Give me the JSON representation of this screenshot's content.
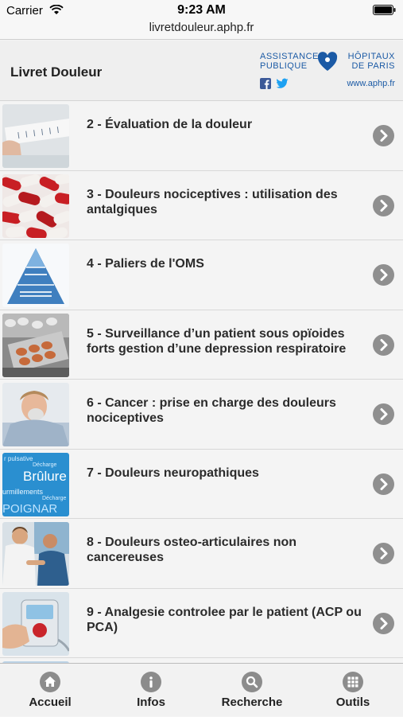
{
  "status": {
    "carrier": "Carrier",
    "time": "9:23 AM"
  },
  "browser": {
    "url": "livretdouleur.aphp.fr"
  },
  "header": {
    "title": "Livret Douleur",
    "logo": {
      "left_line1": "ASSISTANCE",
      "left_line2": "PUBLIQUE",
      "right_line1": "HÔPITAUX",
      "right_line2": "DE PARIS",
      "url": "www.aphp.fr",
      "brand_color": "#1b5aa5"
    }
  },
  "list": {
    "items": [
      {
        "label": "2 - Évaluation de la douleur",
        "thumb": "pain-scale-ruler"
      },
      {
        "label": "3 - Douleurs nociceptives : utilisation des antalgiques",
        "thumb": "capsules"
      },
      {
        "label": "4 - Paliers de l'OMS",
        "thumb": "pyramid"
      },
      {
        "label": "5 - Surveillance d’un patient sous opïoides forts gestion d’une depression respiratoire",
        "thumb": "pills-blister"
      },
      {
        "label": "6 - Cancer : prise en charge des douleurs nociceptives",
        "thumb": "patient-oxygen-mask"
      },
      {
        "label": "7 - Douleurs neuropathiques",
        "thumb": "word-cloud-brulure"
      },
      {
        "label": "8 - Douleurs osteo-articulaires non cancereuses",
        "thumb": "doctor-patient"
      },
      {
        "label": "9 - Analgesie controlee par le patient (ACP ou PCA)",
        "thumb": "pca-pump"
      }
    ],
    "thumb_word_cloud": {
      "line1": "r pulsative",
      "line1b": "Décharge",
      "line2": "Brûlure",
      "line3": "urmillements",
      "line3b": "Décharge",
      "line4": "POIGNAR"
    }
  },
  "tabbar": {
    "tabs": [
      {
        "label": "Accueil",
        "icon": "home-icon"
      },
      {
        "label": "Infos",
        "icon": "info-icon"
      },
      {
        "label": "Recherche",
        "icon": "search-icon"
      },
      {
        "label": "Outils",
        "icon": "grid-icon"
      }
    ]
  }
}
